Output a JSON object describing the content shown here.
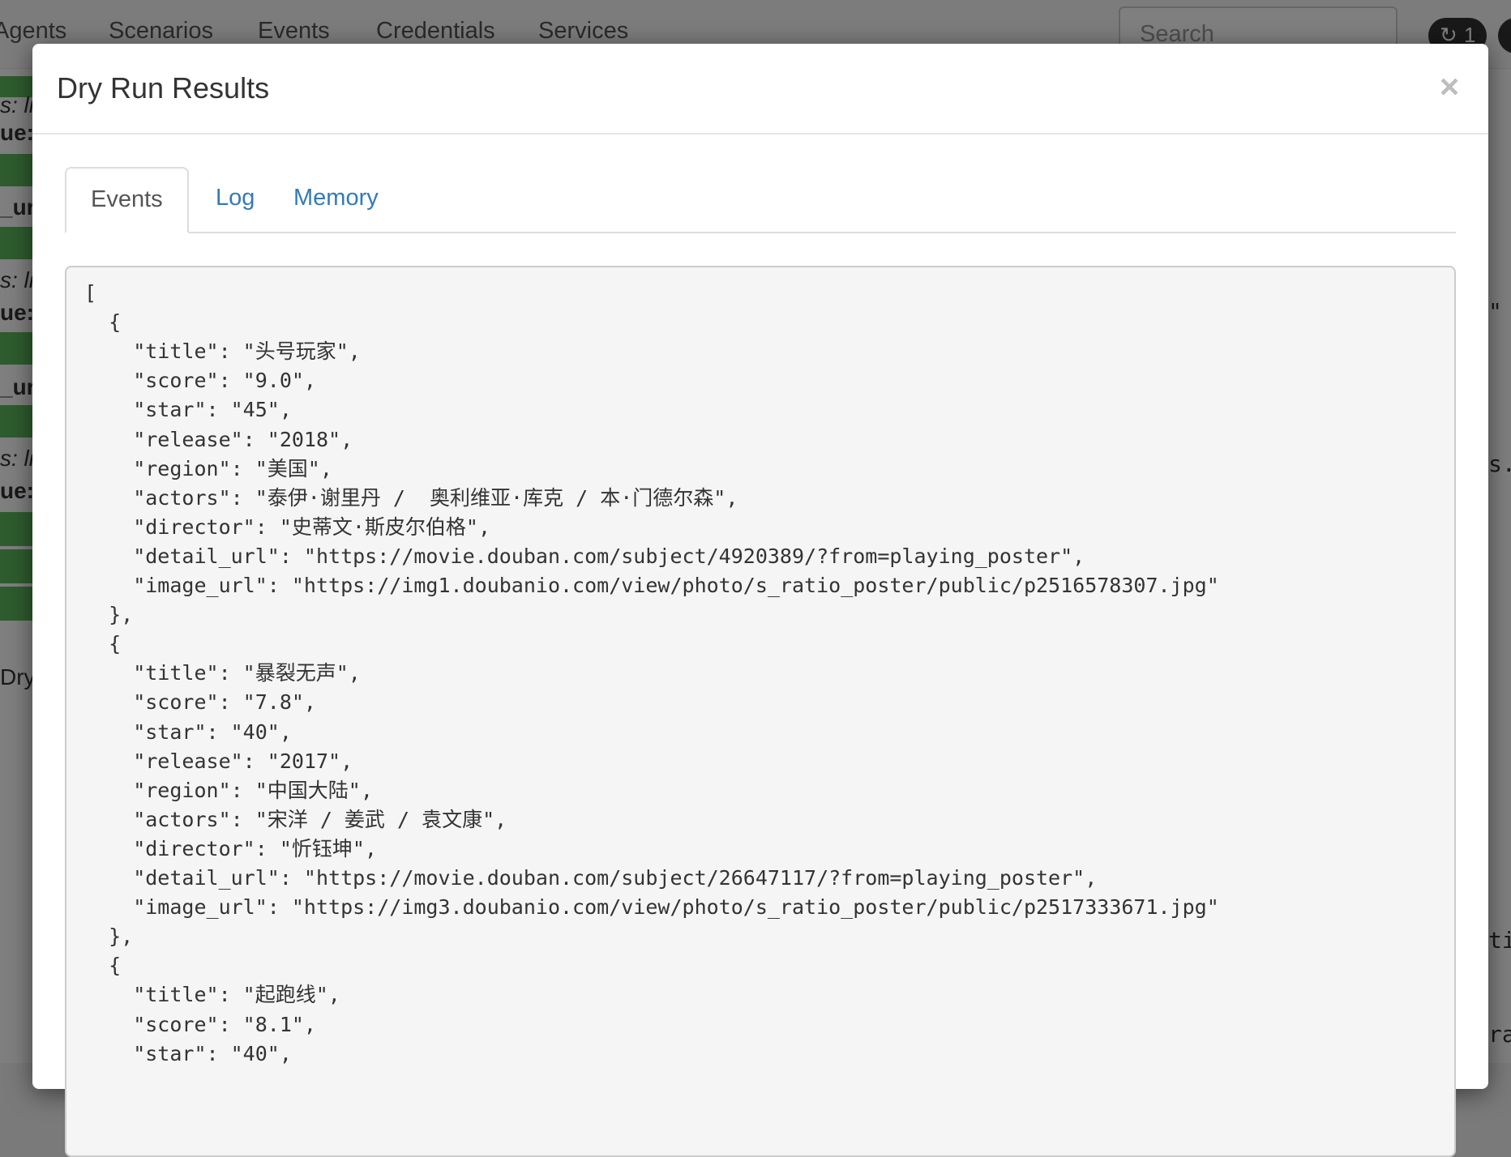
{
  "background": {
    "nav": [
      "Agents",
      "Scenarios",
      "Events",
      "Credentials",
      "Services"
    ],
    "search_placeholder": "Search",
    "badge_count": "1",
    "left_fragments": [
      "s: li",
      "ue:",
      "_url:",
      "s: li",
      "ue:",
      "_url",
      "s: li",
      "ue:",
      "Dry"
    ],
    "right_fragments": [
      "\"",
      "s.",
      "ti",
      "rat"
    ]
  },
  "modal": {
    "title": "Dry Run Results",
    "close_label": "×",
    "tabs": [
      {
        "label": "Events",
        "active": true
      },
      {
        "label": "Log",
        "active": false
      },
      {
        "label": "Memory",
        "active": false
      }
    ],
    "code_lines": [
      "[",
      "  {",
      "    \"title\": \"头号玩家\",",
      "    \"score\": \"9.0\",",
      "    \"star\": \"45\",",
      "    \"release\": \"2018\",",
      "    \"region\": \"美国\",",
      "    \"actors\": \"泰伊·谢里丹 /  奥利维亚·库克 / 本·门德尔森\",",
      "    \"director\": \"史蒂文·斯皮尔伯格\",",
      "    \"detail_url\": \"https://movie.douban.com/subject/4920389/?from=playing_poster\",",
      "    \"image_url\": \"https://img1.doubanio.com/view/photo/s_ratio_poster/public/p2516578307.jpg\"",
      "  },",
      "  {",
      "    \"title\": \"暴裂无声\",",
      "    \"score\": \"7.8\",",
      "    \"star\": \"40\",",
      "    \"release\": \"2017\",",
      "    \"region\": \"中国大陆\",",
      "    \"actors\": \"宋洋 / 姜武 / 袁文康\",",
      "    \"director\": \"忻钰坤\",",
      "    \"detail_url\": \"https://movie.douban.com/subject/26647117/?from=playing_poster\",",
      "    \"image_url\": \"https://img3.doubanio.com/view/photo/s_ratio_poster/public/p2517333671.jpg\"",
      "  },",
      "  {",
      "    \"title\": \"起跑线\",",
      "    \"score\": \"8.1\",",
      "    \"star\": \"40\","
    ]
  }
}
